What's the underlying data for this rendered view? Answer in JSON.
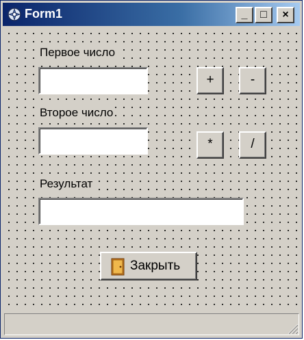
{
  "window": {
    "title": "Form1",
    "icon": "delphi-app-icon",
    "controls": {
      "minimize": "_",
      "maximize": "□",
      "close": "×"
    }
  },
  "form": {
    "first_number_label": "Первое число",
    "first_number_value": "",
    "second_number_label": "Второе число",
    "second_number_value": "",
    "result_label": "Результат",
    "result_value": "",
    "buttons": {
      "add": "+",
      "subtract": "-",
      "multiply": "*",
      "divide": "/"
    },
    "close_button": {
      "label": "Закрыть",
      "icon": "door-exit-icon"
    }
  },
  "status_bar": {
    "text": ""
  },
  "colors": {
    "title_start": "#0a246a",
    "title_end": "#a6caf0",
    "face": "#d4d0c8"
  }
}
